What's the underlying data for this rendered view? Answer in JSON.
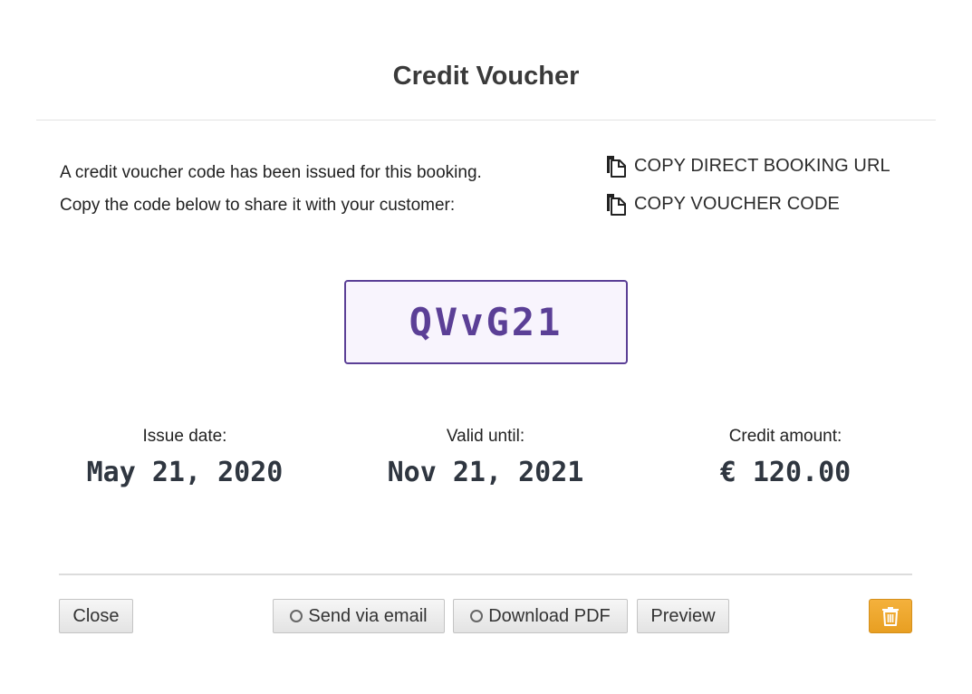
{
  "dialog": {
    "title": "Credit Voucher"
  },
  "intro": {
    "line1": "A credit voucher code has been issued for this booking.",
    "line2": "Copy the code below to share it with your customer:"
  },
  "copy_links": {
    "booking_url": "COPY DIRECT BOOKING URL",
    "voucher_code": "COPY VOUCHER CODE"
  },
  "voucher": {
    "code": "QVvG21"
  },
  "details": {
    "issue_label": "Issue date:",
    "issue_value": "May 21, 2020",
    "valid_label": "Valid until:",
    "valid_value": "Nov 21, 2021",
    "amount_label": "Credit amount:",
    "amount_value": "€ 120.00"
  },
  "footer": {
    "close": "Close",
    "send_email": "Send via email",
    "download_pdf": "Download PDF",
    "preview": "Preview"
  },
  "colors": {
    "accent": "#5b3f96",
    "voucher_bg": "#f8f4fd",
    "delete_button": "#eea52b"
  },
  "icons": {
    "copy": "copy-icon",
    "radio": "radio-circle-icon",
    "delete": "trash-icon"
  }
}
